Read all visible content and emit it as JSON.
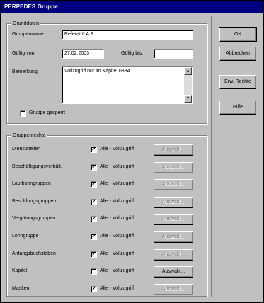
{
  "window": {
    "title": "PERPEDES Gruppe"
  },
  "stammdaten": {
    "legend": "Grunddaten",
    "gruppenname_label": "Gruppenname:",
    "gruppenname_value": "Referat II A 8",
    "gueltig_von_label": "Gültig von:",
    "gueltig_von_value": "27.02.2003",
    "gueltig_bis_label": "Gültig bis:",
    "gueltig_bis_value": "",
    "bemerkung_label": "Bemerkung:",
    "bemerkung_value": "Vollzugriff nur im Kapitel 0884",
    "gesperrt_label": "Gruppe gesperrt",
    "gesperrt_checked": false
  },
  "rechte": {
    "legend": "Gruppenrechte",
    "rows": [
      {
        "label": "Dienststellen",
        "checked": true,
        "checkbox_label": "Alle - Vollzugriff",
        "button_label": "Auswahl...",
        "enabled": false
      },
      {
        "label": "Beschäftigungsverhält.",
        "checked": true,
        "checkbox_label": "Alle - Vollzugriff",
        "button_label": "Auswahl...",
        "enabled": false
      },
      {
        "label": "Laufbahngruppen",
        "checked": true,
        "checkbox_label": "Alle - Vollzugriff",
        "button_label": "Auswahl...",
        "enabled": false
      },
      {
        "label": "Besoldungsgruppen",
        "checked": true,
        "checkbox_label": "Alle - Vollzugriff",
        "button_label": "Auswahl...",
        "enabled": false
      },
      {
        "label": "Vergütungsgruppen",
        "checked": true,
        "checkbox_label": "Alle - Vollzugriff",
        "button_label": "Auswahl...",
        "enabled": false
      },
      {
        "label": "Lohngruppe",
        "checked": true,
        "checkbox_label": "Alle - Vollzugriff",
        "button_label": "Auswahl...",
        "enabled": false
      },
      {
        "label": "Anfangsbuchstaben",
        "checked": true,
        "checkbox_label": "Alle - Vollzugriff",
        "button_label": "Auswahl...",
        "enabled": false
      },
      {
        "label": "Kapitel",
        "checked": false,
        "checkbox_label": "Alle - Vollzugriff",
        "button_label": "Auswahl...",
        "enabled": true
      },
      {
        "label": "Masken",
        "checked": true,
        "checkbox_label": "Alle - Vollzugriff",
        "button_label": "Auswahl...",
        "enabled": false
      }
    ]
  },
  "buttons": {
    "ok": "OK",
    "abbrechen": "Abbrechen",
    "erw_rechte": "Erw. Rechte",
    "hilfe": "Hilfe"
  },
  "glyphs": {
    "check": "✓",
    "scroll_up": "▲",
    "scroll_down": "▼"
  },
  "colors": {
    "face": "#c0c0c0",
    "titlebar": "#00007f",
    "disabled_text": "#808080"
  }
}
